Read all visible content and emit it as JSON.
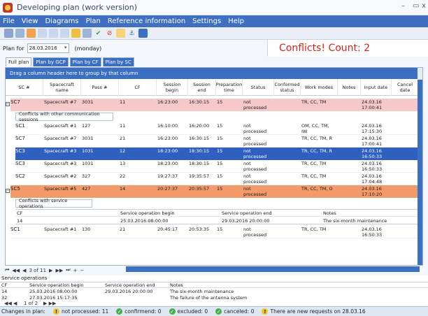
{
  "window": {
    "title": "Developing plan (work version)"
  },
  "menu": [
    "File",
    "View",
    "Diagrams",
    "Plan",
    "Reference information",
    "Settings",
    "Help"
  ],
  "plan": {
    "label": "Plan for",
    "date": "28.03.2016",
    "weekday": "(monday)"
  },
  "conflicts": "Conflicts! Count: 2",
  "tabs": [
    "Full plan",
    "Plan by GCP",
    "Plan by CF",
    "Plan by SC"
  ],
  "grid": {
    "group_hint": "Drag a column header here to group by that column",
    "headers": [
      "SC #",
      "Spacecraft name",
      "Pass #",
      "CF",
      "Session begin",
      "Session end",
      "Preparation time",
      "Status",
      "Conformed status",
      "Work modes",
      "Notes",
      "Input date",
      "Cancel date"
    ],
    "rows": [
      {
        "sc": "SC7",
        "name": "Spacecraft #7",
        "pass": "3031",
        "cf": "11",
        "begin": "16:23:00",
        "end": "16:30:15",
        "prep": "15",
        "status": "not processed",
        "modes": "TR, CC, TM",
        "input": "24.03.16 17:00:41"
      },
      {
        "sc": "SC1",
        "name": "Spacecraft #1",
        "pass": "127",
        "cf": "11",
        "begin": "16:10:00",
        "end": "16:20:00",
        "prep": "15",
        "status": "not processed",
        "modes": "OM, CC, TM, IW",
        "input": "24.03.16 17:15:30"
      },
      {
        "sc": "SC7",
        "name": "Spacecraft #7",
        "pass": "3031",
        "cf": "21",
        "begin": "16:23:00",
        "end": "16:30:15",
        "prep": "15",
        "status": "not processed",
        "modes": "TR, CC, TM, R",
        "input": "24.03.16 17:00:41"
      },
      {
        "sc": "SC3",
        "name": "Spacecraft #3",
        "pass": "1031",
        "cf": "12",
        "begin": "18:23:00",
        "end": "18:30:15",
        "prep": "15",
        "status": "not processed",
        "modes": "TR, CC, TM, R",
        "input": "24.03.16 16:50:33"
      },
      {
        "sc": "SC3",
        "name": "Spacecraft #3",
        "pass": "1031",
        "cf": "13",
        "begin": "18:23:00",
        "end": "18:30:15",
        "prep": "15",
        "status": "not processed",
        "modes": "TR, CC, TM",
        "input": "24.03.16 16:50:33"
      },
      {
        "sc": "SC2",
        "name": "Spacecraft #2",
        "pass": "327",
        "cf": "22",
        "begin": "19:27:37",
        "end": "19:35:57",
        "prep": "15",
        "status": "not processed",
        "modes": "TR, CC, TM",
        "input": "24.03.16 17:04:48"
      },
      {
        "sc": "SC5",
        "name": "Spacecraft #5",
        "pass": "427",
        "cf": "14",
        "begin": "20:27:37",
        "end": "20:35:57",
        "prep": "15",
        "status": "not processed",
        "modes": "TR, CC, TM, O",
        "input": "24.03.16 17:10:20"
      },
      {
        "sc": "SC1",
        "name": "Spacecraft #1",
        "pass": "130",
        "cf": "21",
        "begin": "20:45:17",
        "end": "20:53:35",
        "prep": "15",
        "status": "not processed",
        "modes": "TR, CC, TM",
        "input": "24.03.16 16:50:33"
      }
    ],
    "sub_comm": "Conflicts with other communication sessions",
    "sub_svc": "Conflicts with service operations",
    "sub_svc_headers": [
      "CF",
      "Service operation begin",
      "Service operation end",
      "Notes"
    ],
    "sub_svc_row": {
      "cf": "14",
      "begin": "25.03.2016 08:00:00",
      "end": "29.03.2016 20:00:00",
      "notes": "The six-month maintenance"
    },
    "nav": "3 of 11"
  },
  "service": {
    "title": "Service operations",
    "headers": [
      "CF",
      "Service operation begin",
      "Service operation end",
      "Notes"
    ],
    "rows": [
      {
        "cf": "14",
        "begin": "25.03.2016 08:00:00",
        "end": "29.03.2016 20:00:00",
        "notes": "The six-month maintenance"
      },
      {
        "cf": "32",
        "begin": "27.03.2016 15:17:35",
        "end": "",
        "notes": "The failure of the antenna system"
      }
    ],
    "nav": "1 of 2"
  },
  "status": {
    "changes": "Changes in plan:",
    "not_processed": "not processed: 11",
    "confirmed": "confirmend: 0",
    "excluded": "excluded: 0",
    "canceled": "canceled: 0",
    "new_requests": "There are new requests on 28.03.16"
  }
}
